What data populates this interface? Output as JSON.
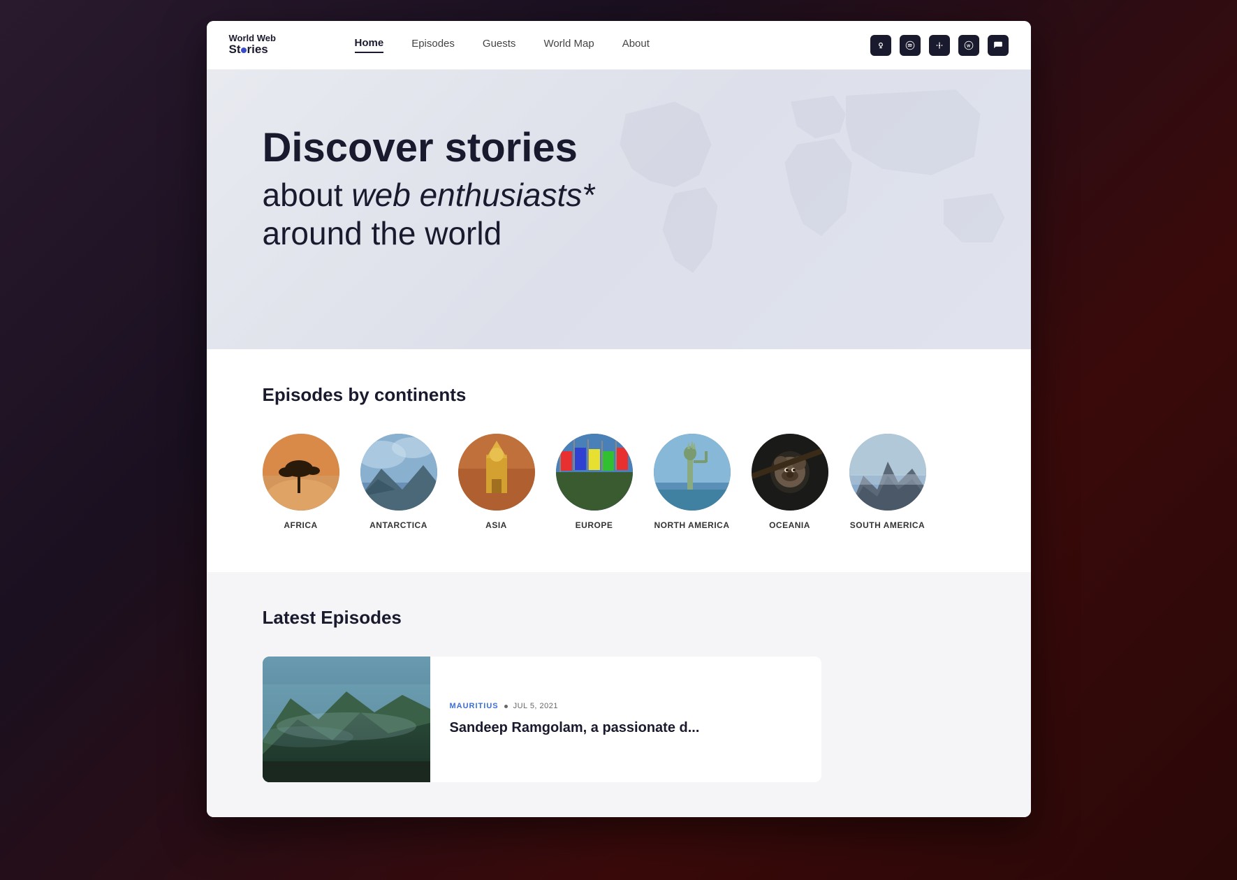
{
  "browser": {
    "window_shadow": true
  },
  "nav": {
    "logo_line1": "World Web",
    "logo_line2": "St*ries",
    "links": [
      {
        "label": "Home",
        "active": true
      },
      {
        "label": "Episodes",
        "active": false
      },
      {
        "label": "Guests",
        "active": false
      },
      {
        "label": "World Map",
        "active": false
      },
      {
        "label": "About",
        "active": false
      }
    ],
    "icons": [
      {
        "name": "podcast-icon",
        "symbol": "🎙"
      },
      {
        "name": "spotify-icon",
        "symbol": "♫"
      },
      {
        "name": "google-podcasts-icon",
        "symbol": "◉"
      },
      {
        "name": "wordpress-icon",
        "symbol": "W"
      },
      {
        "name": "discord-icon",
        "symbol": "💬"
      }
    ]
  },
  "hero": {
    "title_line1": "Discover stories",
    "title_line2_prefix": "about ",
    "title_line2_italic": "web enthusiasts*",
    "title_line3": "around the world"
  },
  "continents_section": {
    "title": "Episodes by continents",
    "continents": [
      {
        "label": "AFRICA",
        "color": "#c8956a"
      },
      {
        "label": "ANTARCTICA",
        "color": "#8aaecc"
      },
      {
        "label": "ASIA",
        "color": "#c4834a"
      },
      {
        "label": "EUROPE",
        "color": "#5a8ab8"
      },
      {
        "label": "NORTH AMERICA",
        "color": "#7ab0cc"
      },
      {
        "label": "OCEANIA",
        "color": "#2a2a2a"
      },
      {
        "label": "SOUTH AMERICA",
        "color": "#9aacb8"
      }
    ]
  },
  "latest_section": {
    "title": "Latest Episodes",
    "episodes": [
      {
        "location": "MAURITIUS",
        "separator": "■",
        "date": "JUL 5, 2021",
        "title": "Sandeep Ramgolam, a passionate d..."
      }
    ]
  }
}
